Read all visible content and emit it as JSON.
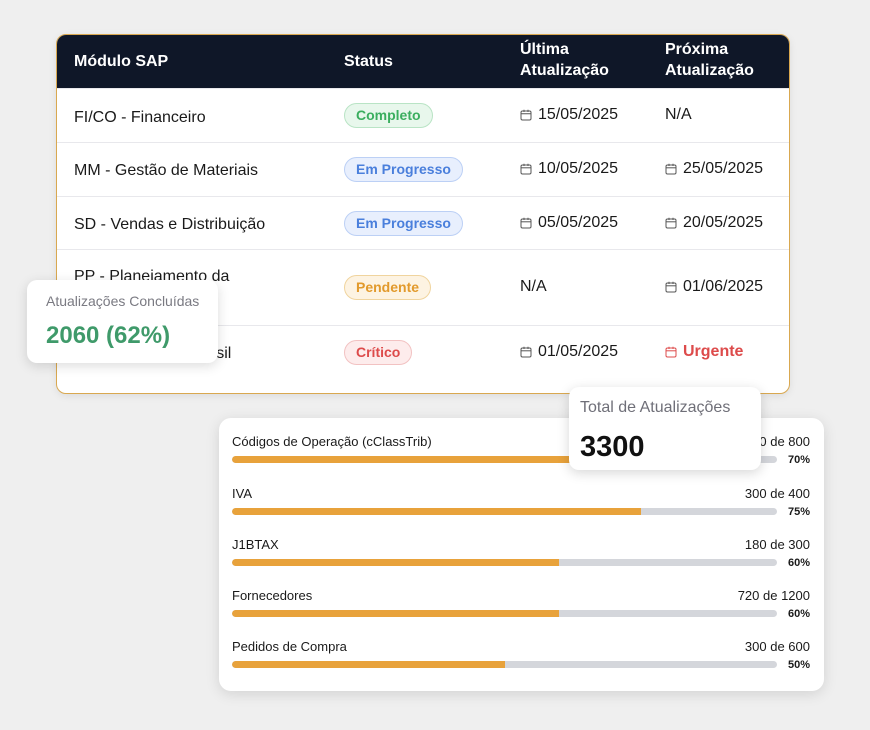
{
  "table": {
    "headers": {
      "module": "Módulo SAP",
      "status": "Status",
      "last_update": "Última Atualização",
      "next_update": "Próxima Atualização"
    },
    "rows": [
      {
        "module": "FI/CO - Financeiro",
        "status": "Completo",
        "status_color": "green",
        "last": "15/05/2025",
        "last_icon": true,
        "next": "N/A",
        "next_icon": false,
        "next_urgent": false
      },
      {
        "module": "MM - Gestão de Materiais",
        "status": "Em Progresso",
        "status_color": "blue",
        "last": "10/05/2025",
        "last_icon": true,
        "next": "25/05/2025",
        "next_icon": true,
        "next_urgent": false
      },
      {
        "module": "SD - Vendas e Distribuição",
        "status": "Em Progresso",
        "status_color": "blue",
        "last": "05/05/2025",
        "last_icon": true,
        "next": "20/05/2025",
        "next_icon": true,
        "next_urgent": false
      },
      {
        "module": "PP - Planejamento da",
        "status": "Pendente",
        "status_color": "orange",
        "last": "N/A",
        "last_icon": false,
        "next": "01/06/2025",
        "next_icon": true,
        "next_urgent": false
      },
      {
        "module": "rasil",
        "status": "Crítico",
        "status_color": "red",
        "last": "01/05/2025",
        "last_icon": true,
        "next": "Urgente",
        "next_icon": true,
        "next_urgent": true
      }
    ]
  },
  "completed": {
    "label": "Atualizações Concluídas",
    "value": "2060 (62%)"
  },
  "total": {
    "label": "Total de Atualizações",
    "value": "3300"
  },
  "progress": [
    {
      "name": "Códigos de Operação (cClassTrib)",
      "count": "0 de 800",
      "percent": 70,
      "percent_label": "70%"
    },
    {
      "name": "IVA",
      "count": "300 de 400",
      "percent": 75,
      "percent_label": "75%"
    },
    {
      "name": "J1BTAX",
      "count": "180 de 300",
      "percent": 60,
      "percent_label": "60%"
    },
    {
      "name": "Fornecedores",
      "count": "720 de 1200",
      "percent": 60,
      "percent_label": "60%"
    },
    {
      "name": "Pedidos de Compra",
      "count": "300 de 600",
      "percent": 50,
      "percent_label": "50%"
    }
  ],
  "colors": {
    "header_bg": "#0f1728",
    "accent_border": "#d9a850",
    "progress_fill": "#e8a23b",
    "progress_track": "#d4d6db",
    "success": "#3f9a6a",
    "danger": "#dd4b4b"
  },
  "icons": {
    "date": "calendar-icon"
  }
}
